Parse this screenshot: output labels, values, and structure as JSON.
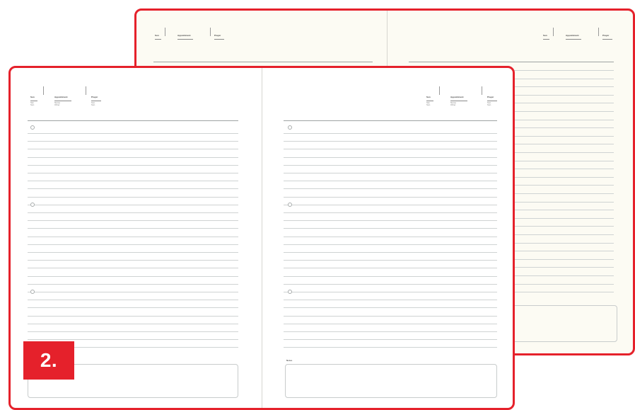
{
  "badge": {
    "label": "2."
  },
  "colors": {
    "frame_border": "#e5212b",
    "back_sheet": "#fcfbf3",
    "front_sheet": "#ffffff",
    "rule_line": "#cfd3d3"
  },
  "header_columns": [
    {
      "title": "Sun",
      "sub1": "Sat",
      "sub2": "Sun"
    },
    {
      "title": "Appointment",
      "sub1": "Name",
      "sub2": "Other"
    },
    {
      "title": "Prayer",
      "sub1": "Sun",
      "sub2": "Sun"
    }
  ],
  "notes_label": "Notes"
}
